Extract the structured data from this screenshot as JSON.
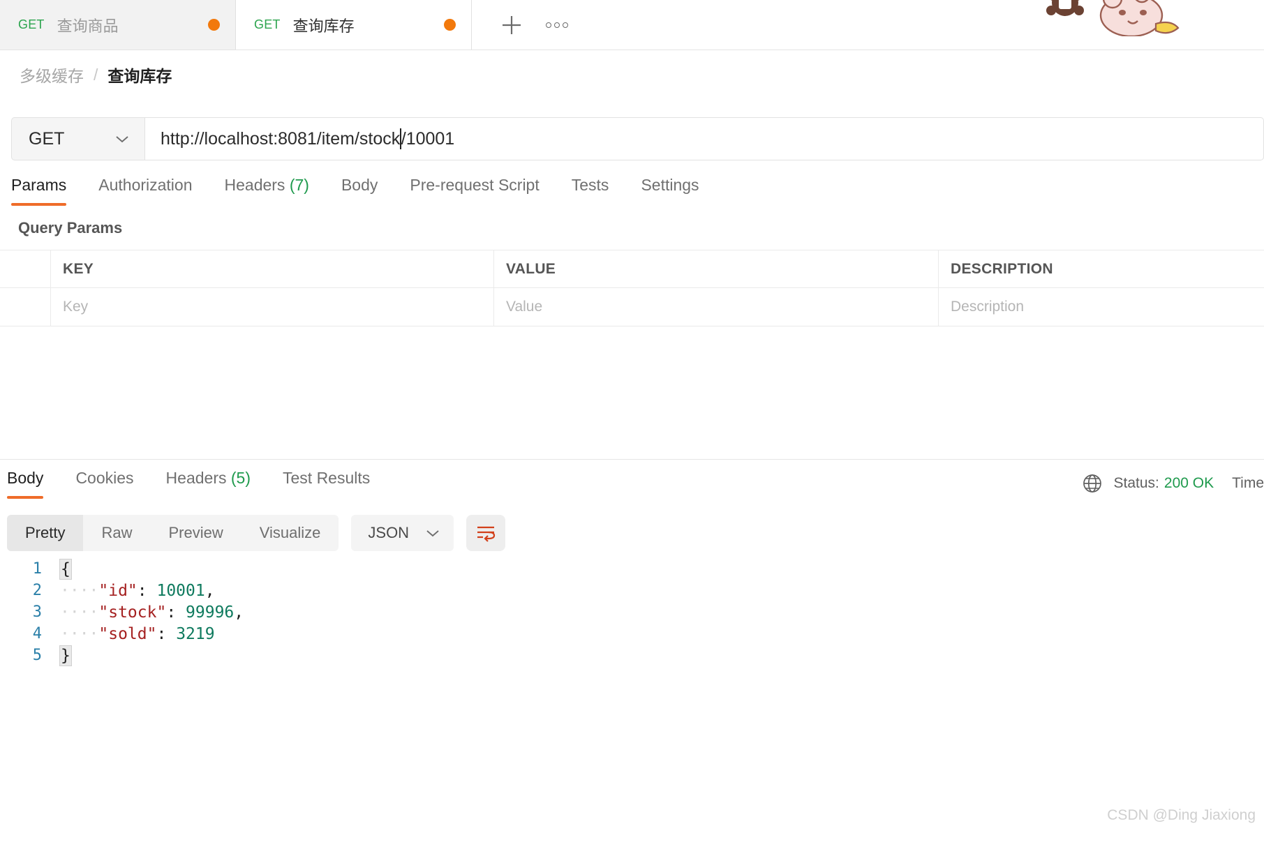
{
  "tabstrip": {
    "tabs": [
      {
        "method": "GET",
        "name": "查询商品",
        "unsaved": true,
        "active": false
      },
      {
        "method": "GET",
        "name": "查询库存",
        "unsaved": true,
        "active": true
      }
    ],
    "new_tab_icon": "plus-icon",
    "more_icon": "ellipsis-icon"
  },
  "breadcrumb": {
    "root": "多级缓存",
    "separator": "/",
    "current": "查询库存"
  },
  "request": {
    "method": "GET",
    "method_dropdown_icon": "chevron-down-icon",
    "url": "http://localhost:8081/item/stock/10001",
    "url_before_caret": "http://localhost:8081/item/stock",
    "url_after_caret": "/10001",
    "tabs": [
      {
        "label": "Params",
        "count": "",
        "active": true
      },
      {
        "label": "Authorization",
        "count": "",
        "active": false
      },
      {
        "label": "Headers",
        "count": "(7)",
        "active": false
      },
      {
        "label": "Body",
        "count": "",
        "active": false
      },
      {
        "label": "Pre-request Script",
        "count": "",
        "active": false
      },
      {
        "label": "Tests",
        "count": "",
        "active": false
      },
      {
        "label": "Settings",
        "count": "",
        "active": false
      }
    ]
  },
  "query_params": {
    "title": "Query Params",
    "headers": {
      "key": "KEY",
      "value": "VALUE",
      "description": "DESCRIPTION"
    },
    "placeholders": {
      "key": "Key",
      "value": "Value",
      "description": "Description"
    }
  },
  "response": {
    "tabs": [
      {
        "label": "Body",
        "count": "",
        "active": true
      },
      {
        "label": "Cookies",
        "count": "",
        "active": false
      },
      {
        "label": "Headers",
        "count": "(5)",
        "active": false
      },
      {
        "label": "Test Results",
        "count": "",
        "active": false
      }
    ],
    "globe_icon": "globe-icon",
    "status_label": "Status:",
    "status_value": "200 OK",
    "time_label": "Time",
    "view_modes": [
      {
        "label": "Pretty",
        "active": true
      },
      {
        "label": "Raw",
        "active": false
      },
      {
        "label": "Preview",
        "active": false
      },
      {
        "label": "Visualize",
        "active": false
      }
    ],
    "format": "JSON",
    "format_dropdown_icon": "chevron-down-icon",
    "wrap_icon": "word-wrap-icon",
    "code_lines": [
      {
        "num": "1",
        "indent": "",
        "key": "",
        "sep": "",
        "value": "",
        "comma": "",
        "brace": "{"
      },
      {
        "num": "2",
        "indent": "····",
        "key": "\"id\"",
        "sep": ": ",
        "value": "10001",
        "comma": ",",
        "brace": ""
      },
      {
        "num": "3",
        "indent": "····",
        "key": "\"stock\"",
        "sep": ": ",
        "value": "99996",
        "comma": ",",
        "brace": ""
      },
      {
        "num": "4",
        "indent": "····",
        "key": "\"sold\"",
        "sep": ": ",
        "value": "3219",
        "comma": "",
        "brace": ""
      },
      {
        "num": "5",
        "indent": "",
        "key": "",
        "sep": "",
        "value": "",
        "comma": "",
        "brace": "}"
      }
    ]
  },
  "watermark": "CSDN @Ding Jiaxiong",
  "colors": {
    "accent": "#ef6c29",
    "method_green": "#2ca44e",
    "status_green": "#1f9a4d",
    "unsaved_dot": "#f2790c",
    "json_key": "#a52121",
    "json_number": "#0f7a5e"
  }
}
